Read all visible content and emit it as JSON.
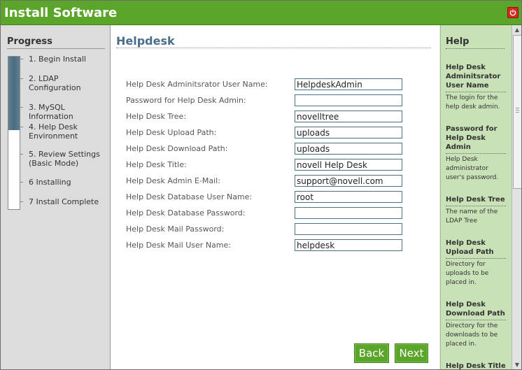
{
  "window": {
    "title": "Install Software"
  },
  "progress": {
    "heading": "Progress",
    "fill_fraction": 0.48,
    "steps": [
      "1. Begin Install",
      "2. LDAP Configuration",
      "3. MySQL Information",
      "4. Help Desk Environment",
      "5. Review Settings (Basic Mode)",
      "6 Installing",
      "7 Install Complete"
    ]
  },
  "main": {
    "heading": "Helpdesk",
    "fields": [
      {
        "label": "Help Desk Adminitsrator User Name:",
        "value": "HelpdeskAdmin"
      },
      {
        "label": "Password for Help Desk Admin:",
        "value": ""
      },
      {
        "label": "Help Desk Tree:",
        "value": "novelltree"
      },
      {
        "label": "Help Desk Upload Path:",
        "value": "uploads"
      },
      {
        "label": "Help Desk Download Path:",
        "value": "uploads"
      },
      {
        "label": "Help Desk Title:",
        "value": "novell Help Desk"
      },
      {
        "label": "Help Desk Admin E-Mail:",
        "value": "support@novell.com"
      },
      {
        "label": "Help Desk Database User Name:",
        "value": "root"
      },
      {
        "label": "Help Desk Database Password:",
        "value": ""
      },
      {
        "label": "Help Desk Mail Password:",
        "value": ""
      },
      {
        "label": "Help Desk Mail User Name:",
        "value": "helpdesk"
      }
    ],
    "back_label": "Back",
    "next_label": "Next"
  },
  "help": {
    "heading": "Help",
    "items": [
      {
        "title": "Help Desk Adminitsrator User Name",
        "desc": "The login for the help desk admin."
      },
      {
        "title": "Password for Help Desk Admin",
        "desc": "Help Desk administrator user's password."
      },
      {
        "title": "Help Desk Tree",
        "desc": "The name of the LDAP Tree"
      },
      {
        "title": "Help Desk Upload Path",
        "desc": "Directory for uploads to be placed in."
      },
      {
        "title": "Help Desk Download Path",
        "desc": "Directory for the downloads to be placed in."
      },
      {
        "title": "Help Desk Title",
        "desc": ""
      }
    ]
  },
  "icons": {
    "close": "power-close-icon",
    "scroll_up": "arrow-up-icon",
    "scroll_down": "arrow-down-icon"
  },
  "colors": {
    "titlebar": "#5aa52a",
    "help_pane": "#c9e1b6",
    "heading": "#4a6e8a",
    "progress_fill": "#4a6d82"
  }
}
